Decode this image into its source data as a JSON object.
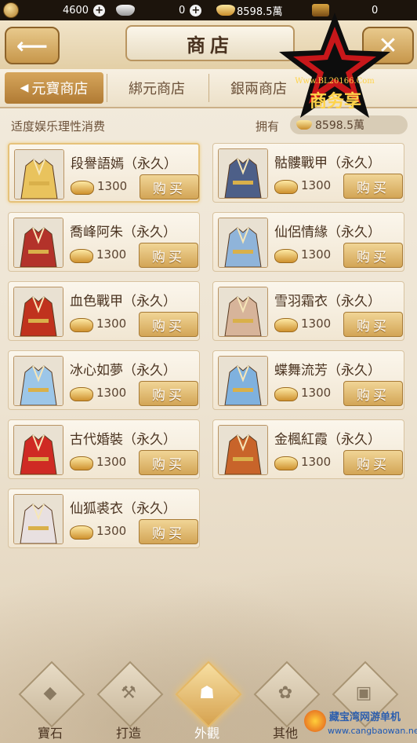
{
  "resources": [
    {
      "icon": "coin-icon",
      "value": "4600",
      "plus": true
    },
    {
      "icon": "silver-ingot-icon",
      "value": "0",
      "plus": true
    },
    {
      "icon": "gold-ingot-icon",
      "value": "8598.5萬",
      "plus": false
    },
    {
      "icon": "chest-icon",
      "value": "0",
      "plus": false
    }
  ],
  "header": {
    "title": "商店",
    "back_icon": "back-arrow-icon",
    "close_icon": "close-icon"
  },
  "tabs": [
    {
      "label": "元寶商店",
      "active": true
    },
    {
      "label": "綁元商店",
      "active": false
    },
    {
      "label": "銀兩商店",
      "active": false
    }
  ],
  "notice": "适度娱乐理性消费",
  "own": {
    "label": "拥有",
    "value": "8598.5萬"
  },
  "items": [
    {
      "name": "段譽語嫣（永久）",
      "price": "1300",
      "buy": "购买",
      "selected": true,
      "color": "#e9c35d"
    },
    {
      "name": "骷髏戰甲（永久）",
      "price": "1300",
      "buy": "购买",
      "selected": false,
      "color": "#4d5f88"
    },
    {
      "name": "喬峰阿朱（永久）",
      "price": "1300",
      "buy": "购买",
      "selected": false,
      "color": "#b3322a"
    },
    {
      "name": "仙侶情緣（永久）",
      "price": "1300",
      "buy": "购买",
      "selected": false,
      "color": "#8fb4da"
    },
    {
      "name": "血色戰甲（永久）",
      "price": "1300",
      "buy": "购买",
      "selected": false,
      "color": "#c0321e"
    },
    {
      "name": "雪羽霜衣（永久）",
      "price": "1300",
      "buy": "购买",
      "selected": false,
      "color": "#d7b49a"
    },
    {
      "name": "冰心如夢（永久）",
      "price": "1300",
      "buy": "购买",
      "selected": false,
      "color": "#9cc6e8"
    },
    {
      "name": "蝶舞流芳（永久）",
      "price": "1300",
      "buy": "购买",
      "selected": false,
      "color": "#7fb1de"
    },
    {
      "name": "古代婚裝（永久）",
      "price": "1300",
      "buy": "购买",
      "selected": false,
      "color": "#cf2a24"
    },
    {
      "name": "金楓紅霞（永久）",
      "price": "1300",
      "buy": "购买",
      "selected": false,
      "color": "#c8642a"
    },
    {
      "name": "仙狐裘衣（永久）",
      "price": "1300",
      "buy": "购买",
      "selected": false,
      "color": "#e8e0e0"
    }
  ],
  "nav": [
    {
      "label": "寶石",
      "icon": "gem-icon",
      "glyph": "◆",
      "active": false
    },
    {
      "label": "打造",
      "icon": "anvil-icon",
      "glyph": "⚒",
      "active": false
    },
    {
      "label": "外觀",
      "icon": "mask-icon",
      "glyph": "☗",
      "active": true
    },
    {
      "label": "其他",
      "icon": "flower-icon",
      "glyph": "✿",
      "active": false
    },
    {
      "label": "",
      "icon": "bag-icon",
      "glyph": "▣",
      "active": false
    }
  ],
  "watermark": {
    "site": "Www.BL20166.Com",
    "text": "商务享",
    "bottom_text": "藏宝湾网游单机",
    "bottom_url": "www.cangbaowan.net"
  },
  "colors": {
    "accent": "#d3a556",
    "header_bar": "#1c140c",
    "active_tab": "#c28a3e"
  }
}
